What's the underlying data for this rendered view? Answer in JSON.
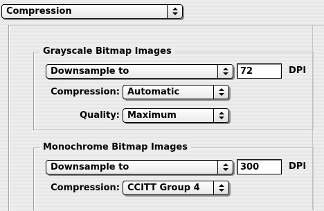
{
  "header": {
    "section_popup": "Compression"
  },
  "grayscale": {
    "group_title": "Grayscale Bitmap Images",
    "downsample_popup": "Downsample to",
    "dpi_value": "72",
    "dpi_unit": "DPI",
    "compression_label": "Compression:",
    "compression_value": "Automatic",
    "quality_label": "Quality:",
    "quality_value": "Maximum"
  },
  "monochrome": {
    "group_title": "Monochrome Bitmap Images",
    "downsample_popup": "Downsample to",
    "dpi_value": "300",
    "dpi_unit": "DPI",
    "compression_label": "Compression:",
    "compression_value": "CCITT Group 4"
  },
  "icons": {
    "popup_arrows": "up-down-arrows-icon"
  }
}
